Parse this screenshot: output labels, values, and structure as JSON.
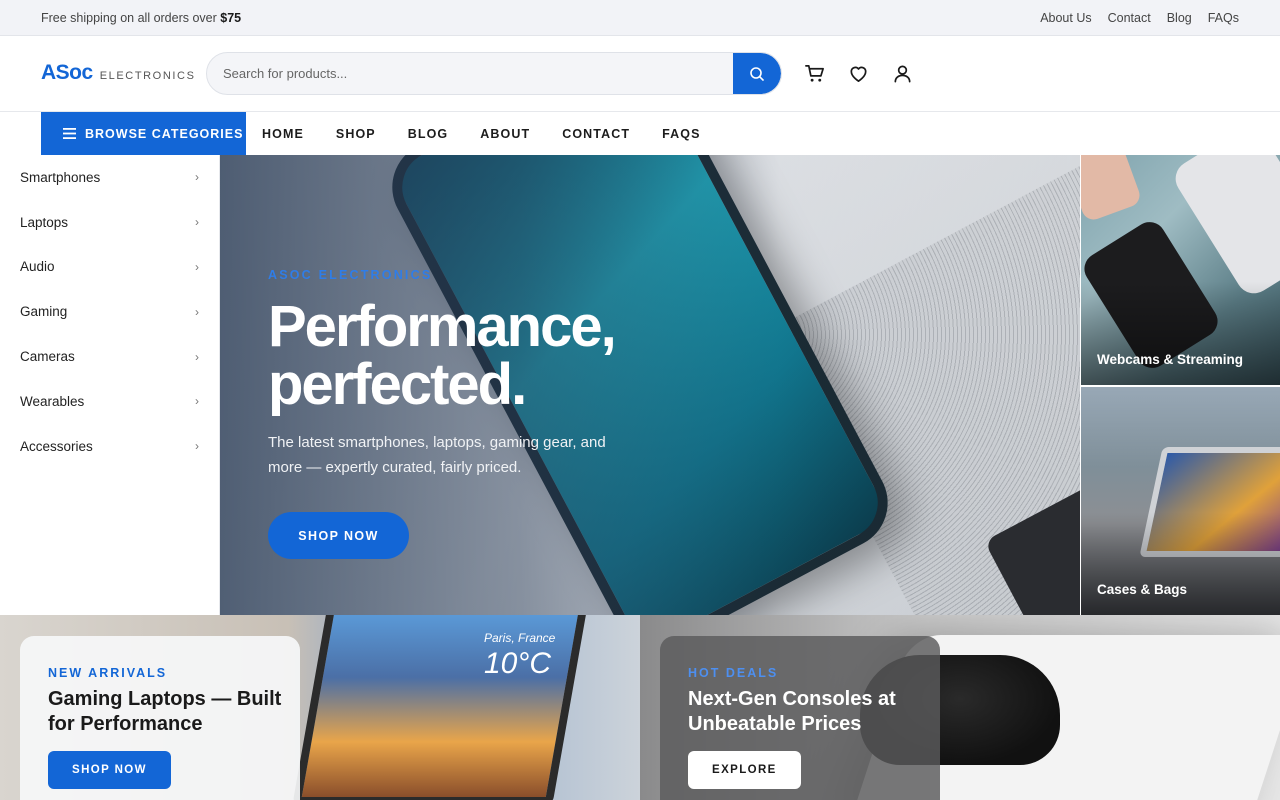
{
  "topbar": {
    "shipping_prefix": "Free shipping on all orders over",
    "shipping_amount": "$75",
    "links": [
      "About Us",
      "Contact",
      "Blog",
      "FAQs"
    ]
  },
  "header": {
    "logo_main": "ASoc",
    "logo_sub": "ELECTRONICS",
    "search_placeholder": "Search for products...",
    "icons": [
      "search-icon",
      "cart-icon",
      "heart-icon",
      "user-icon"
    ]
  },
  "nav": {
    "browse_label": "BROWSE CATEGORIES",
    "links": [
      "HOME",
      "SHOP",
      "BLOG",
      "ABOUT",
      "CONTACT",
      "FAQS"
    ]
  },
  "sidebar": {
    "categories": [
      "Smartphones",
      "Laptops",
      "Audio",
      "Gaming",
      "Cameras",
      "Wearables",
      "Accessories"
    ],
    "chevron": "›"
  },
  "hero": {
    "eyebrow": "ASOC ELECTRONICS",
    "title": "Performance, perfected.",
    "subtitle": "The latest smartphones, laptops, gaming gear, and more — expertly curated, fairly priced.",
    "cta": "SHOP NOW"
  },
  "tiles": [
    {
      "label": "Webcams & Streaming"
    },
    {
      "label": "Cases & Bags"
    }
  ],
  "promos": [
    {
      "eyebrow": "NEW ARRIVALS",
      "title": "Gaming Laptops — Built for Performance",
      "cta": "SHOP NOW",
      "screen_city": "Paris, France",
      "screen_temp": "10°C"
    },
    {
      "eyebrow": "HOT DEALS",
      "title": "Next-Gen Consoles at Unbeatable Prices",
      "cta": "EXPLORE"
    }
  ],
  "colors": {
    "accent": "#1366d6",
    "topbar_bg": "#f2f3f7"
  }
}
